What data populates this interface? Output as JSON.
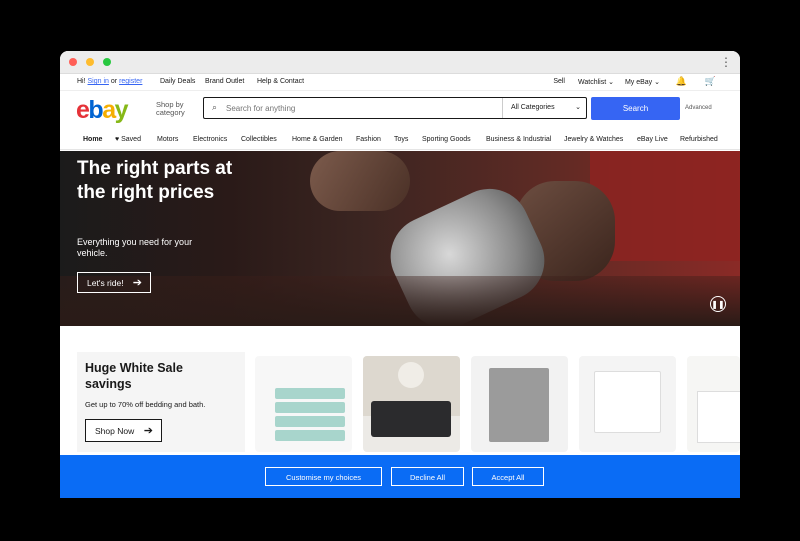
{
  "topbar": {
    "greeting": "Hi!",
    "sign_in": "Sign in",
    "or": "or",
    "register": "register",
    "nav": [
      "Daily Deals",
      "Brand Outlet",
      "Help & Contact"
    ],
    "sell": "Sell",
    "watchlist": "Watchlist",
    "myebay": "My eBay",
    "bell_icon": "bell-icon",
    "cart_icon": "cart-icon"
  },
  "header": {
    "logo": [
      "e",
      "b",
      "a",
      "y"
    ],
    "shop_by": "Shop by category",
    "search_placeholder": "Search for anything",
    "category": "All Categories",
    "search_button": "Search",
    "advanced": "Advanced"
  },
  "catnav": [
    "Home",
    "Saved",
    "Motors",
    "Electronics",
    "Collectibles",
    "Home & Garden",
    "Fashion",
    "Toys",
    "Sporting Goods",
    "Business & Industrial",
    "Jewelry & Watches",
    "eBay Live",
    "Refurbished"
  ],
  "hero": {
    "title": "The right parts at the right prices",
    "subtitle": "Everything you need for your vehicle.",
    "cta": "Let's ride!"
  },
  "promo": {
    "title": "Huge White Sale savings",
    "text": "Get up to 70% off bedding and bath.",
    "cta": "Shop Now"
  },
  "consent": {
    "customise": "Customise my choices",
    "decline": "Decline All",
    "accept": "Accept All"
  },
  "colors": {
    "brand_blue": "#3665f3",
    "consent_blue": "#0a6cf5"
  }
}
